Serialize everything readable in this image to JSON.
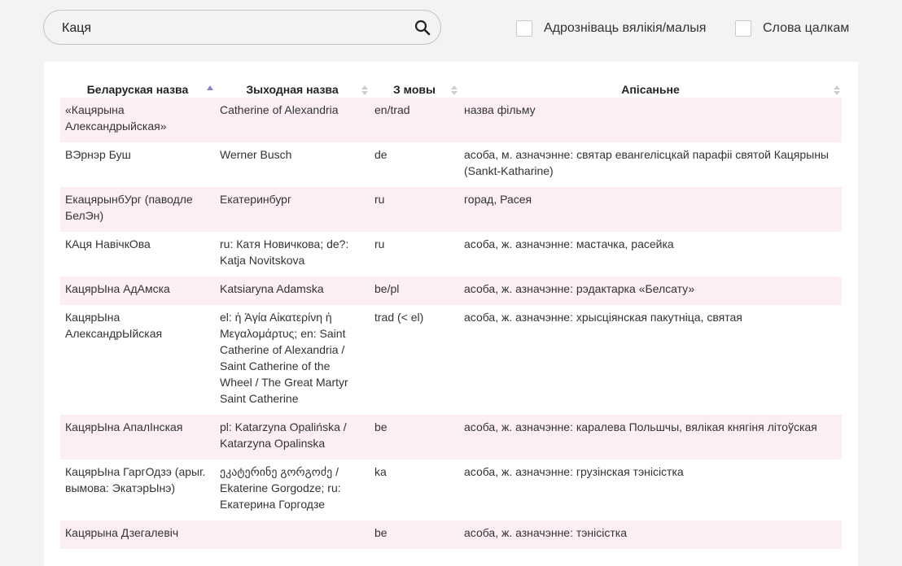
{
  "search": {
    "value": "Каця",
    "placeholder": ""
  },
  "options": {
    "case_sensitive": "Адрозніваць вялікія/малыя",
    "whole_words": "Слова цалкам"
  },
  "table": {
    "columns": [
      "Беларуская назва",
      "Зыходная назва",
      "З мовы",
      "Апісаньне"
    ],
    "rows": [
      {
        "be": "«Кацярына Александрыйская»",
        "orig": "Catherine of Alexandria",
        "lang": "en/trad",
        "desc": "назва фільму"
      },
      {
        "be": "ВЭрнэр Буш",
        "orig": "Werner Busch",
        "lang": "de",
        "desc": "асоба, м. азначэнне: святар евангелісцкай парафіі святой Кацярыны (Sankt-Katharine)"
      },
      {
        "be": "ЕкацярынбУрг (паводле БелЭн)",
        "orig": "Екатеринбург",
        "lang": "ru",
        "desc": "горад, Расея"
      },
      {
        "be": "КАця НавічкОва",
        "orig": "ru: Катя Новичкова; de?: Katja Novitskova",
        "lang": "ru",
        "desc": "асоба, ж. азначэнне: мастачка, расейка"
      },
      {
        "be": "КацярЫна АдАмска",
        "orig": "Katsiaryna Adamska",
        "lang": "be/pl",
        "desc": "асоба, ж. азначэнне: рэдактарка «Белсату»"
      },
      {
        "be": "КацярЫна АлександрЫйская",
        "orig": "el: ἡ Ἁγία Αἰκατερίνη ἡ Μεγαλομάρτυς; en: Saint Catherine of Alexandria / Saint Catherine of the Wheel / The Great Martyr Saint Catherine",
        "lang": "trad (< el)",
        "desc": "асоба, ж. азначэнне: хрысціянская пакутніца, святая"
      },
      {
        "be": "КацярЫна АпалІнская",
        "orig": "pl: Katarzyna Opalińska / Katarzyna Opalinska",
        "lang": "be",
        "desc": "асоба, ж. азначэнне: каралева Польшчы, вялікая княгіня літоўская"
      },
      {
        "be": "КацярЫна ГаргОдзэ (арыг. вымова: ЭкатэрЫнэ)",
        "orig": "ეკატერინე გორგოძე / Ekaterine Gorgodze; ru: Екатерина Горгодзе",
        "lang": "ka",
        "desc": "асоба, ж. азначэнне: грузінская тэнісістка"
      },
      {
        "be": "Кацярына Дзегалевіч",
        "orig": "",
        "lang": "be",
        "desc": "асоба, ж. азначэнне: тэнісістка"
      }
    ]
  },
  "colors": {
    "row_tint": "#fdeff1",
    "sort_active": "#8a7fd6",
    "sort_inactive": "#cccccc"
  }
}
